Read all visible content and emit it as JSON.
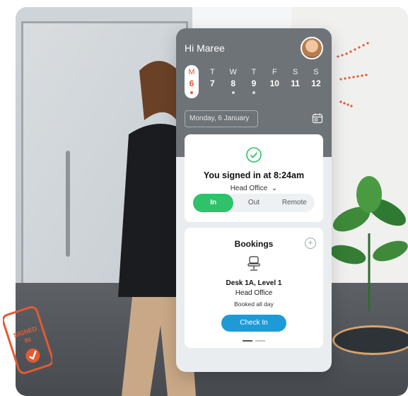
{
  "header": {
    "greeting": "Hi Maree"
  },
  "week": [
    {
      "letter": "M",
      "num": "6",
      "dot": true,
      "active": true
    },
    {
      "letter": "T",
      "num": "7",
      "dot": false
    },
    {
      "letter": "W",
      "num": "8",
      "dot": true
    },
    {
      "letter": "T",
      "num": "9",
      "dot": true
    },
    {
      "letter": "F",
      "num": "10",
      "dot": false
    },
    {
      "letter": "S",
      "num": "11",
      "dot": false
    },
    {
      "letter": "S",
      "num": "12",
      "dot": false
    }
  ],
  "date_field": {
    "value": "Monday, 6 January"
  },
  "signin": {
    "status": "You signed in at 8:24am",
    "location": "Head Office",
    "segments": [
      "In",
      "Out",
      "Remote"
    ],
    "selected": "In"
  },
  "bookings": {
    "title": "Bookings",
    "desk": "Desk 1A, Level 1",
    "office": "Head Office",
    "note": "Booked all day",
    "button": "Check In"
  },
  "decor": {
    "badge_text": "SIGNED IN"
  },
  "colors": {
    "accent": "#e35a32",
    "success": "#2fc26b",
    "primary": "#1e9bd6",
    "header": "#6e7377"
  },
  "icons": [
    "avatar",
    "calendar-icon",
    "check-circle-icon",
    "chevron-down-icon",
    "plus-icon",
    "chair-icon"
  ]
}
